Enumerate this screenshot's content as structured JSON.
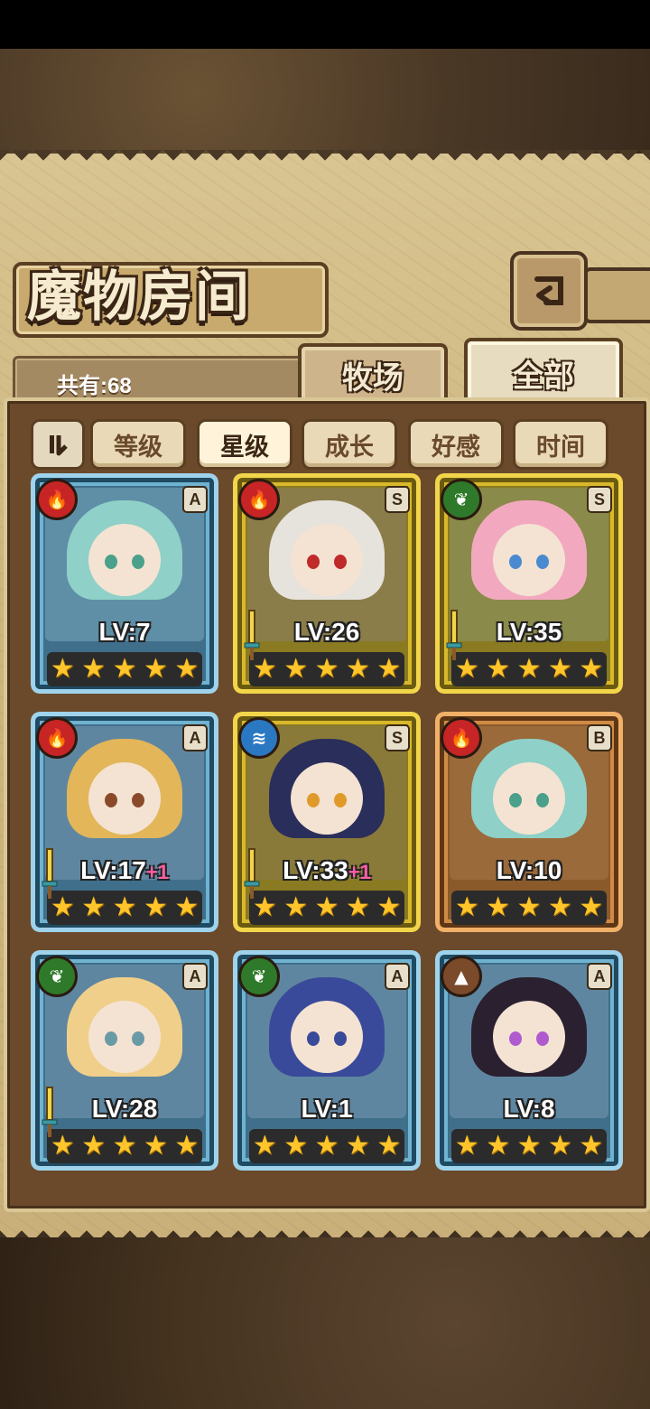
{
  "header": {
    "title": "魔物房间",
    "back_icon": "back-arrow-icon"
  },
  "count": {
    "label": "共有:68"
  },
  "tabs": [
    {
      "label": "牧场",
      "active": false
    },
    {
      "label": "全部",
      "active": true
    }
  ],
  "sort": {
    "toggle_icon": "sort-toggle-icon",
    "buttons": [
      {
        "label": "等级",
        "active": false
      },
      {
        "label": "星级",
        "active": true
      },
      {
        "label": "成长",
        "active": false
      },
      {
        "label": "好感",
        "active": false
      },
      {
        "label": "时间",
        "active": false
      }
    ]
  },
  "monsters": [
    {
      "level": "LV:7",
      "bonus": "",
      "rank": "A",
      "element": "fire",
      "stars": 5,
      "frame": "blue",
      "has_weapon": false
    },
    {
      "level": "LV:26",
      "bonus": "",
      "rank": "S",
      "element": "fire",
      "stars": 5,
      "frame": "gold",
      "has_weapon": true
    },
    {
      "level": "LV:35",
      "bonus": "",
      "rank": "S",
      "element": "leaf",
      "stars": 5,
      "frame": "gold",
      "has_weapon": true
    },
    {
      "level": "LV:17",
      "bonus": "+1",
      "rank": "A",
      "element": "fire",
      "stars": 5,
      "frame": "blue",
      "has_weapon": true
    },
    {
      "level": "LV:33",
      "bonus": "+1",
      "rank": "S",
      "element": "water",
      "stars": 5,
      "frame": "gold",
      "has_weapon": true
    },
    {
      "level": "LV:10",
      "bonus": "",
      "rank": "B",
      "element": "fire",
      "stars": 5,
      "frame": "bronze",
      "has_weapon": false
    },
    {
      "level": "LV:28",
      "bonus": "",
      "rank": "A",
      "element": "leaf",
      "stars": 5,
      "frame": "blue",
      "has_weapon": true
    },
    {
      "level": "LV:1",
      "bonus": "",
      "rank": "A",
      "element": "leaf",
      "stars": 5,
      "frame": "blue",
      "has_weapon": false
    },
    {
      "level": "LV:8",
      "bonus": "",
      "rank": "A",
      "element": "earth",
      "stars": 5,
      "frame": "blue",
      "has_weapon": false
    }
  ],
  "colors": {
    "parchment": "#cdb57e",
    "panel": "#6b4a2b",
    "star": "#ffc52a",
    "bonus": "#ff5fa8"
  }
}
